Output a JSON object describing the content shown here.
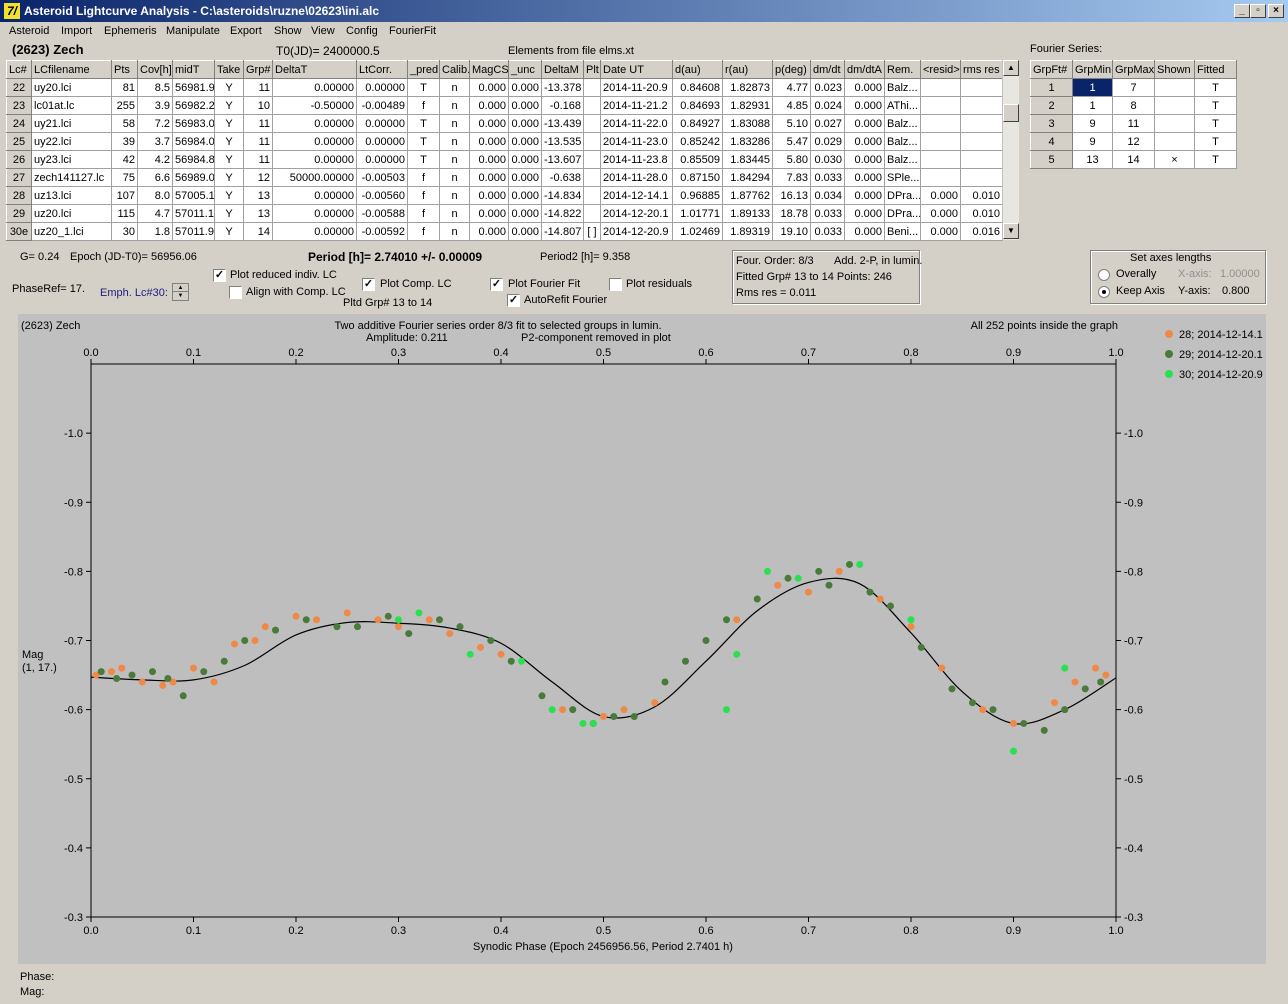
{
  "window": {
    "title": "Asteroid Lightcurve Analysis - C:\\asteroids\\ruzne\\02623\\ini.alc",
    "icon_letter": "7/",
    "min": "_",
    "max": "▫",
    "close": "×"
  },
  "menu": [
    "Asteroid",
    "Import",
    "Ephemeris",
    "Manipulate",
    "Export",
    "Show",
    "View",
    "Config",
    "FourierFit"
  ],
  "header": {
    "asteroid": "(2623) Zech",
    "t0": "T0(JD)= 2400000.5",
    "elements": "Elements from file elms.xt",
    "fourier_label": "Fourier Series:"
  },
  "lc_table": {
    "columns": [
      "Lc#",
      "LCfilename",
      "Pts",
      "Cov[h]",
      "midT",
      "Take",
      "Grp#",
      "DeltaT",
      "LtCorr.",
      "_pred.",
      "Calib.",
      "MagCS",
      "_unc",
      "DeltaM",
      "Plt",
      "Date UT",
      "d(au)",
      "r(au)",
      "p(deg)",
      "dm/dt",
      "dm/dtA",
      "Rem.",
      "<resid>",
      "rms res"
    ],
    "rows": [
      [
        "22",
        "uy20.lci",
        "81",
        "8.5",
        "56981.9",
        "Y",
        "11",
        "0.00000",
        "0.00000",
        "T",
        "n",
        "0.000",
        "0.000",
        "-13.378",
        "",
        "2014-11-20.9",
        "0.84608",
        "1.82873",
        "4.77",
        "0.023",
        "0.000",
        "Balz...",
        "",
        ""
      ],
      [
        "23",
        "lc01at.lc",
        "255",
        "3.9",
        "56982.2",
        "Y",
        "10",
        "-0.50000",
        "-0.00489",
        "f",
        "n",
        "0.000",
        "0.000",
        "-0.168",
        "",
        "2014-11-21.2",
        "0.84693",
        "1.82931",
        "4.85",
        "0.024",
        "0.000",
        "AThi...",
        "",
        ""
      ],
      [
        "24",
        "uy21.lci",
        "58",
        "7.2",
        "56983.0",
        "Y",
        "11",
        "0.00000",
        "0.00000",
        "T",
        "n",
        "0.000",
        "0.000",
        "-13.439",
        "",
        "2014-11-22.0",
        "0.84927",
        "1.83088",
        "5.10",
        "0.027",
        "0.000",
        "Balz...",
        "",
        ""
      ],
      [
        "25",
        "uy22.lci",
        "39",
        "3.7",
        "56984.0",
        "Y",
        "11",
        "0.00000",
        "0.00000",
        "T",
        "n",
        "0.000",
        "0.000",
        "-13.535",
        "",
        "2014-11-23.0",
        "0.85242",
        "1.83286",
        "5.47",
        "0.029",
        "0.000",
        "Balz...",
        "",
        ""
      ],
      [
        "26",
        "uy23.lci",
        "42",
        "4.2",
        "56984.8",
        "Y",
        "11",
        "0.00000",
        "0.00000",
        "T",
        "n",
        "0.000",
        "0.000",
        "-13.607",
        "",
        "2014-11-23.8",
        "0.85509",
        "1.83445",
        "5.80",
        "0.030",
        "0.000",
        "Balz...",
        "",
        ""
      ],
      [
        "27",
        "zech141127.lc",
        "75",
        "6.6",
        "56989.0",
        "Y",
        "12",
        "50000.00000",
        "-0.00503",
        "f",
        "n",
        "0.000",
        "0.000",
        "-0.638",
        "",
        "2014-11-28.0",
        "0.87150",
        "1.84294",
        "7.83",
        "0.033",
        "0.000",
        "SPle...",
        "",
        ""
      ],
      [
        "28",
        "uz13.lci",
        "107",
        "8.0",
        "57005.1",
        "Y",
        "13",
        "0.00000",
        "-0.00560",
        "f",
        "n",
        "0.000",
        "0.000",
        "-14.834",
        "",
        "2014-12-14.1",
        "0.96885",
        "1.87762",
        "16.13",
        "0.034",
        "0.000",
        "DPra...",
        "0.000",
        "0.010"
      ],
      [
        "29",
        "uz20.lci",
        "115",
        "4.7",
        "57011.1",
        "Y",
        "13",
        "0.00000",
        "-0.00588",
        "f",
        "n",
        "0.000",
        "0.000",
        "-14.822",
        "",
        "2014-12-20.1",
        "1.01771",
        "1.89133",
        "18.78",
        "0.033",
        "0.000",
        "DPra...",
        "0.000",
        "0.010"
      ],
      [
        "30e",
        "uz20_1.lci",
        "30",
        "1.8",
        "57011.9",
        "Y",
        "14",
        "0.00000",
        "-0.00592",
        "f",
        "n",
        "0.000",
        "0.000",
        "-14.807",
        "[ ]",
        "2014-12-20.9",
        "1.02469",
        "1.89319",
        "19.10",
        "0.033",
        "0.000",
        "Beni...",
        "0.000",
        "0.016"
      ]
    ]
  },
  "fourier_table": {
    "columns": [
      "GrpFt#",
      "GrpMin",
      "GrpMax",
      "Shown",
      "Fitted"
    ],
    "rows": [
      [
        "1",
        "1",
        "7",
        "",
        "T"
      ],
      [
        "2",
        "1",
        "8",
        "",
        "T"
      ],
      [
        "3",
        "9",
        "11",
        "",
        "T"
      ],
      [
        "4",
        "9",
        "12",
        "",
        "T"
      ],
      [
        "5",
        "13",
        "14",
        "×",
        "T"
      ]
    ]
  },
  "controls": {
    "g": "G= 0.24",
    "epoch": "Epoch (JD-T0)= 56956.06",
    "period": "Period [h]= 2.74010 +/- 0.00009",
    "period2": "Period2 [h]= 9.358",
    "phaseref": "PhaseRef= 17.",
    "emph": "Emph. Lc#30:",
    "plot_reduced": "Plot reduced indiv. LC",
    "align": "Align with Comp. LC",
    "plot_comp": "Plot Comp. LC",
    "pltd": "Pltd Grp#  13 to   14",
    "plot_fourier": "Plot Fourier Fit",
    "autorefit": "AutoRefit Fourier",
    "plot_resid": "Plot residuals",
    "four_order": "Four. Order:  8/3",
    "add": "Add. 2-P, in lumin.",
    "fitted": "Fitted Grp# 13 to 14 Points: 246",
    "rms": "Rms res    = 0.011",
    "axes_title": "Set axes lengths",
    "overally": "Overally",
    "keep": "Keep Axis",
    "xaxis": "X-axis:",
    "xval": "1.00000",
    "yaxis": "Y-axis:",
    "yval": "0.800"
  },
  "plot": {
    "topleft": "(2623) Zech",
    "title1": "Two additive Fourier series order 8/3 fit to selected groups in lumin.",
    "amplitude": "Amplitude: 0.211",
    "p2": "P2-component removed in plot",
    "topright": "All 252 points inside the graph",
    "ylabel1": "Mag",
    "ylabel2": "(1, 17.)",
    "xlabel": "Synodic Phase (Epoch 2456956.56, Period 2.7401 h)",
    "legend": [
      {
        "label": "28; 2014-12-14.1",
        "color": "#f08848"
      },
      {
        "label": "29; 2014-12-20.1",
        "color": "#4a7a3a"
      },
      {
        "label": "30; 2014-12-20.9",
        "color": "#28e050"
      }
    ]
  },
  "status": {
    "phase": "Phase:",
    "mag": "Mag:"
  },
  "chart_data": {
    "type": "scatter",
    "xlim": [
      0,
      1
    ],
    "ylim": [
      -1.1,
      -0.3
    ],
    "xticks": [
      0.0,
      0.1,
      0.2,
      0.3,
      0.4,
      0.5,
      0.6,
      0.7,
      0.8,
      0.9,
      1.0
    ],
    "yticks": [
      -1.0,
      -0.9,
      -0.8,
      -0.7,
      -0.6,
      -0.5,
      -0.4,
      -0.3
    ],
    "fit": {
      "x": [
        0,
        0.05,
        0.1,
        0.15,
        0.2,
        0.25,
        0.3,
        0.35,
        0.4,
        0.45,
        0.5,
        0.55,
        0.6,
        0.65,
        0.7,
        0.75,
        0.8,
        0.85,
        0.9,
        0.95,
        1.0
      ],
      "y": [
        -0.647,
        -0.643,
        -0.643,
        -0.664,
        -0.708,
        -0.726,
        -0.725,
        -0.718,
        -0.696,
        -0.64,
        -0.59,
        -0.604,
        -0.67,
        -0.743,
        -0.784,
        -0.782,
        -0.711,
        -0.626,
        -0.58,
        -0.6,
        -0.646
      ]
    },
    "series": [
      {
        "name": "28; 2014-12-14.1",
        "color": "#f08848",
        "x": [
          0.005,
          0.02,
          0.03,
          0.05,
          0.07,
          0.08,
          0.1,
          0.12,
          0.14,
          0.16,
          0.17,
          0.2,
          0.22,
          0.25,
          0.28,
          0.3,
          0.33,
          0.35,
          0.38,
          0.4,
          0.46,
          0.5,
          0.52,
          0.55,
          0.63,
          0.67,
          0.7,
          0.73,
          0.77,
          0.8,
          0.83,
          0.87,
          0.9,
          0.94,
          0.96,
          0.98,
          0.99
        ],
        "y": [
          -0.65,
          -0.655,
          -0.66,
          -0.64,
          -0.635,
          -0.64,
          -0.66,
          -0.64,
          -0.695,
          -0.7,
          -0.72,
          -0.735,
          -0.73,
          -0.74,
          -0.73,
          -0.72,
          -0.73,
          -0.71,
          -0.69,
          -0.68,
          -0.6,
          -0.59,
          -0.6,
          -0.61,
          -0.73,
          -0.78,
          -0.77,
          -0.8,
          -0.76,
          -0.72,
          -0.66,
          -0.6,
          -0.58,
          -0.61,
          -0.64,
          -0.66,
          -0.65
        ]
      },
      {
        "name": "29; 2014-12-20.1",
        "color": "#4a7a3a",
        "x": [
          0.01,
          0.025,
          0.04,
          0.06,
          0.075,
          0.09,
          0.11,
          0.13,
          0.15,
          0.18,
          0.21,
          0.24,
          0.26,
          0.29,
          0.31,
          0.34,
          0.36,
          0.39,
          0.41,
          0.44,
          0.47,
          0.49,
          0.51,
          0.53,
          0.56,
          0.58,
          0.6,
          0.62,
          0.65,
          0.68,
          0.71,
          0.72,
          0.74,
          0.76,
          0.78,
          0.81,
          0.84,
          0.86,
          0.88,
          0.91,
          0.93,
          0.95,
          0.97,
          0.985
        ],
        "y": [
          -0.655,
          -0.645,
          -0.65,
          -0.655,
          -0.645,
          -0.62,
          -0.655,
          -0.67,
          -0.7,
          -0.715,
          -0.73,
          -0.72,
          -0.72,
          -0.735,
          -0.71,
          -0.73,
          -0.72,
          -0.7,
          -0.67,
          -0.62,
          -0.6,
          -0.58,
          -0.59,
          -0.59,
          -0.64,
          -0.67,
          -0.7,
          -0.73,
          -0.76,
          -0.79,
          -0.8,
          -0.78,
          -0.81,
          -0.77,
          -0.75,
          -0.69,
          -0.63,
          -0.61,
          -0.6,
          -0.58,
          -0.57,
          -0.6,
          -0.63,
          -0.64
        ]
      },
      {
        "name": "30; 2014-12-20.9",
        "color": "#28e050",
        "x": [
          0.3,
          0.32,
          0.37,
          0.42,
          0.45,
          0.48,
          0.49,
          0.62,
          0.63,
          0.66,
          0.69,
          0.75,
          0.8,
          0.9,
          0.95
        ],
        "y": [
          -0.73,
          -0.74,
          -0.68,
          -0.67,
          -0.6,
          -0.58,
          -0.58,
          -0.6,
          -0.68,
          -0.8,
          -0.79,
          -0.81,
          -0.73,
          -0.54,
          -0.66
        ]
      }
    ]
  }
}
